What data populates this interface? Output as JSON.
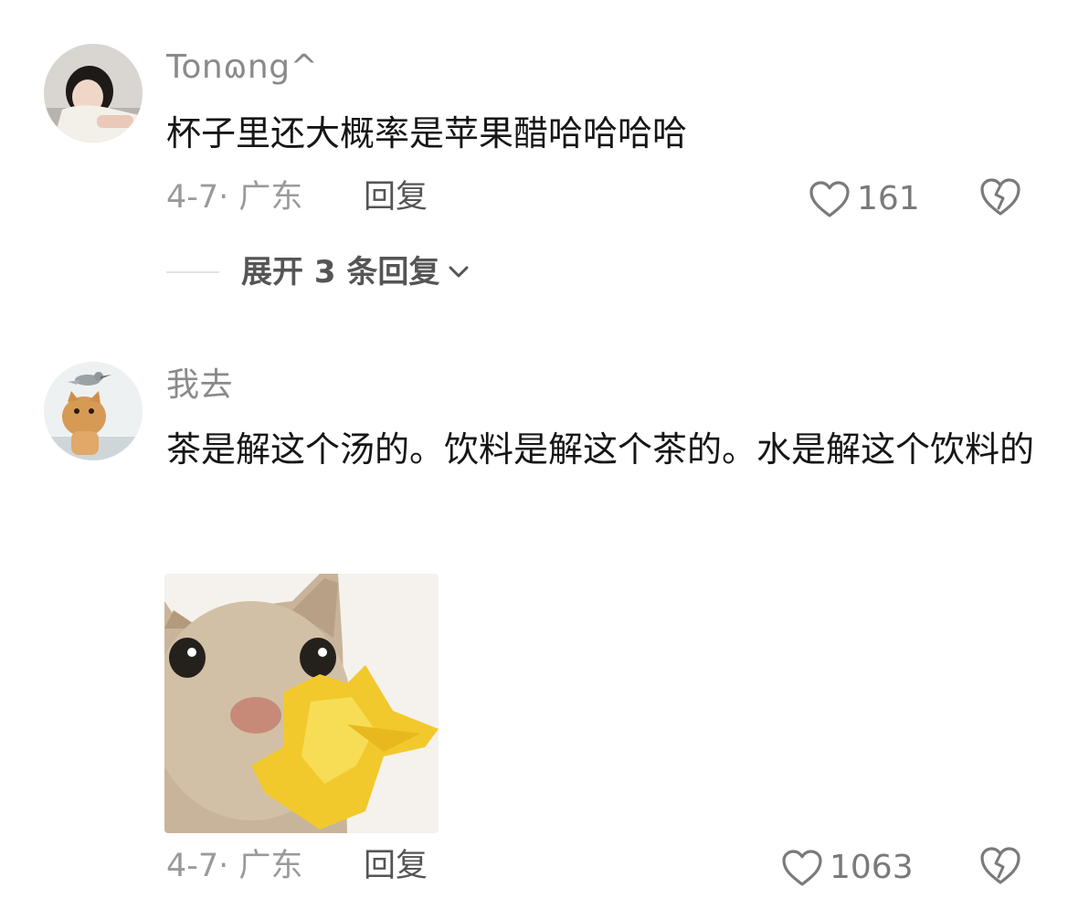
{
  "comments": [
    {
      "username": "Tonɷng^",
      "text": "杯子里还大概率是苹果醋哈哈哈哈",
      "meta": "4-7· 广东",
      "reply_label": "回复",
      "like_count": "161",
      "expand_label": "展开 3 条回复"
    },
    {
      "username": "我去",
      "text": "茶是解这个汤的。饮料是解这个茶的。水是解这个饮料的",
      "meta": "4-7· 广东",
      "reply_label": "回复",
      "like_count": "1063"
    }
  ],
  "icons": {
    "like": "heart-outline-icon",
    "dislike": "broken-heart-icon",
    "expand": "chevron-down-icon"
  },
  "colors": {
    "username": "#8a8a8a",
    "text": "#161616",
    "meta": "#9a9a9a",
    "action": "#555555"
  }
}
